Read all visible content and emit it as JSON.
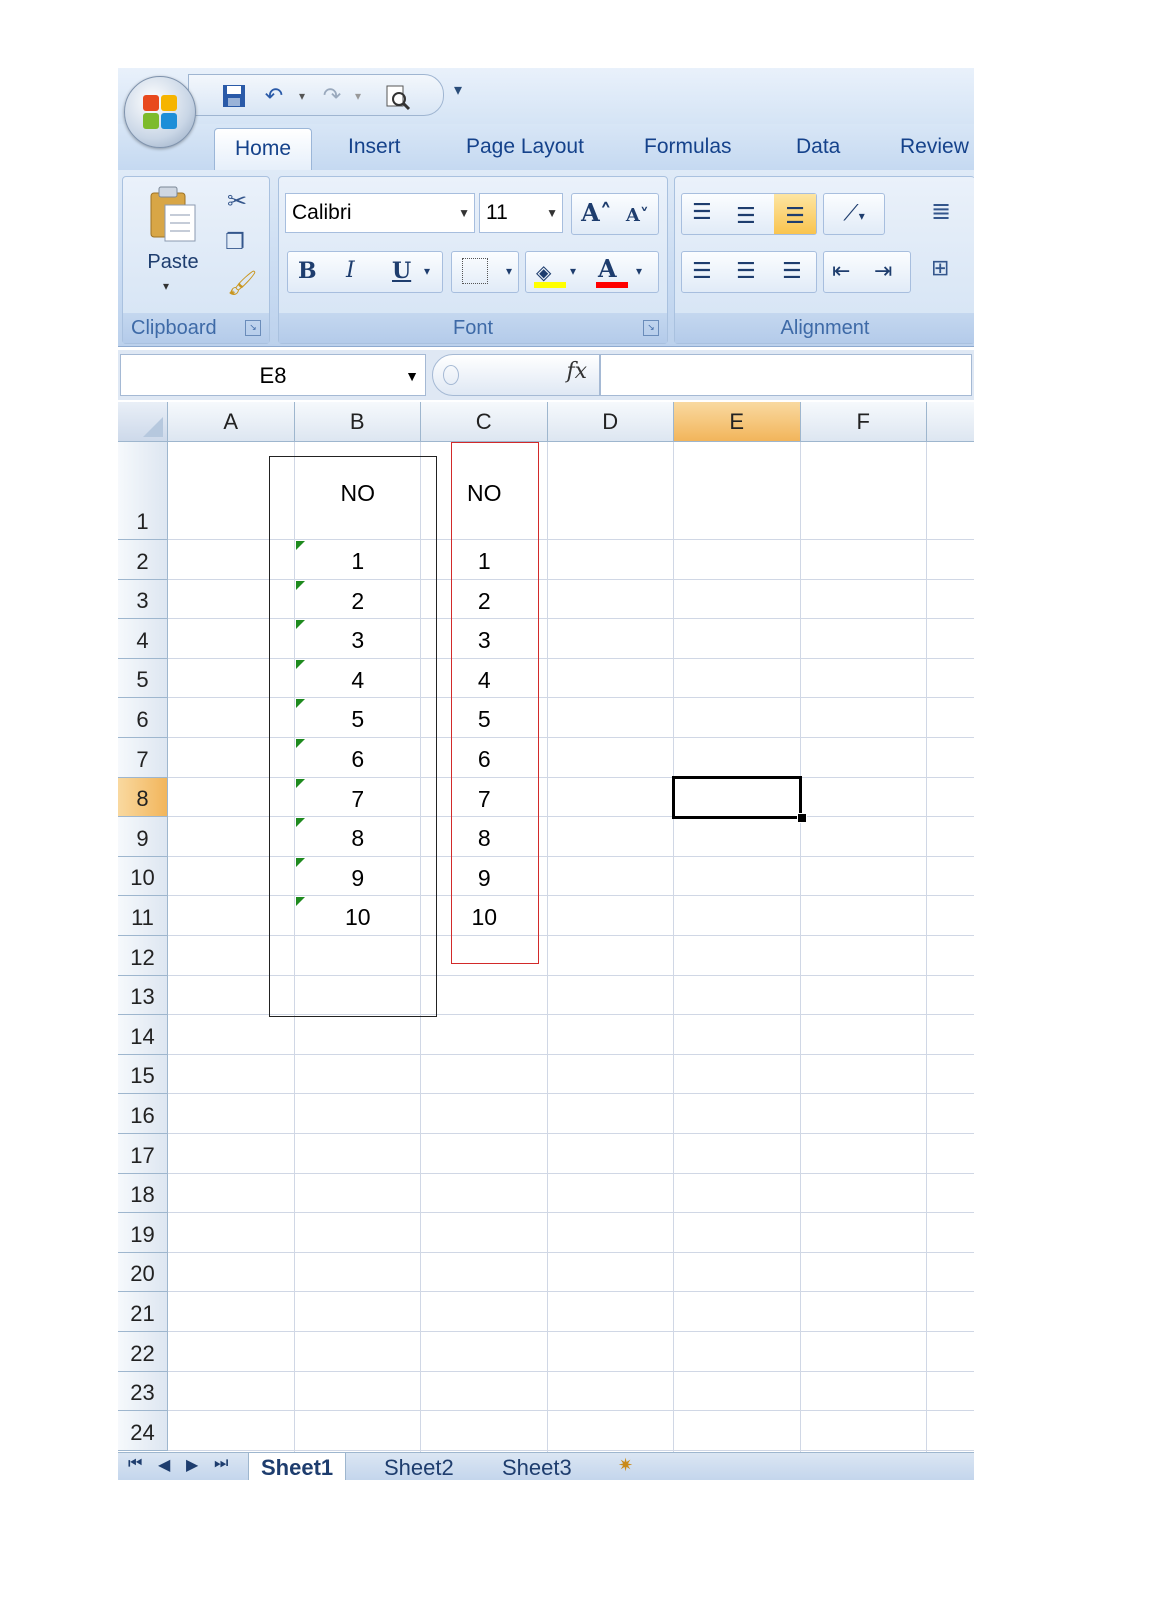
{
  "qat": {
    "save_icon": "save-icon",
    "undo_icon": "undo-icon",
    "redo_icon": "redo-icon",
    "preview_icon": "print-preview-icon",
    "customize_glyph": "▾"
  },
  "tabs": [
    {
      "label": "Home",
      "active": true
    },
    {
      "label": "Insert"
    },
    {
      "label": "Page Layout"
    },
    {
      "label": "Formulas"
    },
    {
      "label": "Data"
    },
    {
      "label": "Review"
    }
  ],
  "clipboard": {
    "paste_label": "Paste",
    "group_label": "Clipboard"
  },
  "font": {
    "name": "Calibri",
    "size": "11",
    "group_label": "Font",
    "bold": "B",
    "italic": "I",
    "underline": "U",
    "grow": "A˄",
    "shrink": "A˅",
    "fill_color": "#ffff00",
    "font_color": "#ff0000"
  },
  "alignment": {
    "group_label": "Alignment"
  },
  "formula_bar": {
    "name_box": "E8",
    "fx": "fx",
    "value": ""
  },
  "columns": [
    "A",
    "B",
    "C",
    "D",
    "E",
    "F"
  ],
  "selected_column": "E",
  "rows": [
    "1",
    "2",
    "3",
    "4",
    "5",
    "6",
    "7",
    "8",
    "9",
    "10",
    "11",
    "12",
    "13",
    "14",
    "15",
    "16",
    "17",
    "18",
    "19",
    "20",
    "21",
    "22",
    "23",
    "24"
  ],
  "selected_row": "8",
  "cells": {
    "B": [
      "NO",
      "1",
      "2",
      "3",
      "4",
      "5",
      "6",
      "7",
      "8",
      "9",
      "10"
    ],
    "C": [
      "NO",
      "1",
      "2",
      "3",
      "4",
      "5",
      "6",
      "7",
      "8",
      "9",
      "10"
    ]
  },
  "colors": {
    "outline_b": "#222222",
    "outline_c": "#d22a2a",
    "error_triangle": "#1e8a1e"
  },
  "sheets": [
    {
      "label": "Sheet1",
      "active": true
    },
    {
      "label": "Sheet2"
    },
    {
      "label": "Sheet3"
    }
  ]
}
